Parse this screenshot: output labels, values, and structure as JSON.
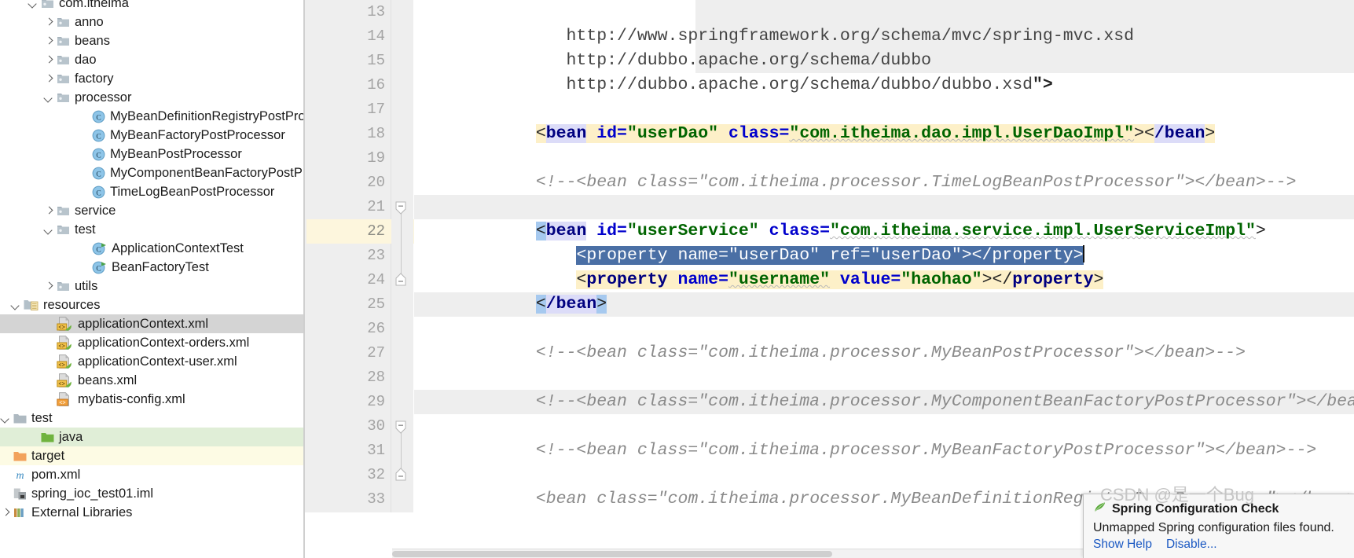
{
  "project_tree": {
    "items": [
      {
        "label": "com.itheima",
        "indent": 55,
        "arrow": "down",
        "icon": "package-icon",
        "state": "none"
      },
      {
        "label": "anno",
        "indent": 75,
        "arrow": "right",
        "icon": "package-icon",
        "state": "none"
      },
      {
        "label": "beans",
        "indent": 75,
        "arrow": "right",
        "icon": "package-icon",
        "state": "none"
      },
      {
        "label": "dao",
        "indent": 75,
        "arrow": "right",
        "icon": "package-icon",
        "state": "none"
      },
      {
        "label": "factory",
        "indent": 75,
        "arrow": "right",
        "icon": "package-icon",
        "state": "none"
      },
      {
        "label": "processor",
        "indent": 75,
        "arrow": "down",
        "icon": "package-icon",
        "state": "none"
      },
      {
        "label": "MyBeanDefinitionRegistryPostProcessor",
        "indent": 120,
        "arrow": "none",
        "icon": "class-icon",
        "state": "none"
      },
      {
        "label": "MyBeanFactoryPostProcessor",
        "indent": 120,
        "arrow": "none",
        "icon": "class-icon",
        "state": "none"
      },
      {
        "label": "MyBeanPostProcessor",
        "indent": 120,
        "arrow": "none",
        "icon": "class-icon",
        "state": "none"
      },
      {
        "label": "MyComponentBeanFactoryPostProcessor",
        "indent": 120,
        "arrow": "none",
        "icon": "class-icon",
        "state": "none"
      },
      {
        "label": "TimeLogBeanPostProcessor",
        "indent": 120,
        "arrow": "none",
        "icon": "class-icon",
        "state": "none"
      },
      {
        "label": "service",
        "indent": 75,
        "arrow": "right",
        "icon": "package-icon",
        "state": "none"
      },
      {
        "label": "test",
        "indent": 75,
        "arrow": "down",
        "icon": "package-icon",
        "state": "none"
      },
      {
        "label": "ApplicationContextTest",
        "indent": 120,
        "arrow": "none",
        "icon": "test-class-icon",
        "state": "none"
      },
      {
        "label": "BeanFactoryTest",
        "indent": 120,
        "arrow": "none",
        "icon": "test-class-icon",
        "state": "none"
      },
      {
        "label": "utils",
        "indent": 75,
        "arrow": "right",
        "icon": "package-icon",
        "state": "none"
      },
      {
        "label": "resources",
        "indent": 33,
        "arrow": "down",
        "icon": "resources-folder-icon",
        "state": "none"
      },
      {
        "label": "applicationContext.xml",
        "indent": 75,
        "arrow": "none",
        "icon": "spring-xml-icon",
        "state": "selected-gray"
      },
      {
        "label": "applicationContext-orders.xml",
        "indent": 75,
        "arrow": "none",
        "icon": "spring-xml-icon",
        "state": "none"
      },
      {
        "label": "applicationContext-user.xml",
        "indent": 75,
        "arrow": "none",
        "icon": "spring-xml-icon",
        "state": "none"
      },
      {
        "label": "beans.xml",
        "indent": 75,
        "arrow": "none",
        "icon": "spring-xml-icon",
        "state": "none"
      },
      {
        "label": "mybatis-config.xml",
        "indent": 75,
        "arrow": "none",
        "icon": "xml-icon",
        "state": "none"
      },
      {
        "label": "test",
        "indent": 10,
        "arrow": "down",
        "icon": "gray-folder-icon",
        "state": "none"
      },
      {
        "label": "java",
        "indent": 55,
        "arrow": "none",
        "icon": "green-folder-icon",
        "state": "highlight-green"
      },
      {
        "label": "target",
        "indent": 10,
        "arrow": "none",
        "icon": "orange-folder-icon",
        "state": "highlight-cream"
      },
      {
        "label": "pom.xml",
        "indent": 10,
        "arrow": "none",
        "icon": "maven-icon",
        "state": "none"
      },
      {
        "label": "spring_ioc_test01.iml",
        "indent": 10,
        "arrow": "none",
        "icon": "iml-icon",
        "state": "none"
      },
      {
        "label": "External Libraries",
        "indent": 10,
        "arrow": "right",
        "icon": "library-icon",
        "state": "none"
      }
    ]
  },
  "editor": {
    "line_numbers": [
      "13",
      "14",
      "15",
      "16",
      "17",
      "18",
      "19",
      "20",
      "21",
      "22",
      "23",
      "24",
      "25",
      "26",
      "27",
      "28",
      "29",
      "30",
      "31",
      "32",
      "33"
    ],
    "current_line": "22",
    "lines": [
      {
        "n": "13",
        "text": "       http://www.springframework.org/schema/mvc/spring-mvc.xsd"
      },
      {
        "n": "14",
        "text": "       http://dubbo.apache.org/schema/dubbo"
      },
      {
        "n": "15",
        "text": "       http://dubbo.apache.org/schema/dubbo/dubbo.xsd\">"
      },
      {
        "n": "16",
        "text": ""
      },
      {
        "n": "17",
        "text": "    <bean id=\"userDao\" class=\"com.itheima.dao.impl.UserDaoImpl\"></bean>"
      },
      {
        "n": "18",
        "text": ""
      },
      {
        "n": "19",
        "text": "    <!--<bean class=\"com.itheima.processor.TimeLogBeanPostProcessor\"></bean>-->"
      },
      {
        "n": "20",
        "text": ""
      },
      {
        "n": "21",
        "text": "    <bean id=\"userService\" class=\"com.itheima.service.impl.UserServiceImpl\">"
      },
      {
        "n": "22",
        "text": "        <property name=\"userDao\" ref=\"userDao\"></property>"
      },
      {
        "n": "23",
        "text": "        <property name=\"username\" value=\"haohao\"></property>"
      },
      {
        "n": "24",
        "text": "    </bean>"
      },
      {
        "n": "25",
        "text": ""
      },
      {
        "n": "26",
        "text": "    <!--<bean class=\"com.itheima.processor.MyBeanPostProcessor\"></bean>-->"
      },
      {
        "n": "27",
        "text": ""
      },
      {
        "n": "28",
        "text": "    <!--<bean class=\"com.itheima.processor.MyComponentBeanFactoryPostProcessor\"></bean>-->"
      },
      {
        "n": "29",
        "text": ""
      },
      {
        "n": "30",
        "text": "    <!--<bean class=\"com.itheima.processor.MyBeanFactoryPostProcessor\"></bean>-->"
      },
      {
        "n": "31",
        "text": ""
      },
      {
        "n": "32",
        "text": "    <bean class=\"com.itheima.processor.MyBeanDefinitionRegistryPostProcessor\"></bean>"
      },
      {
        "n": "33",
        "text": ""
      }
    ],
    "tok": {
      "l13": "       http://www.springframework.org/schema/mvc/spring-mvc.xsd",
      "l14": "       http://dubbo.apache.org/schema/dubbo",
      "l15a": "       http://dubbo.apache.org/schema/dubbo/dubbo.xsd",
      "l15b": "\">",
      "l17_lt": "<",
      "l17_bean": "bean",
      "l17_sp": " ",
      "l17_id": "id=",
      "l17_idv": "\"userDao\"",
      "l17_cls": "class=",
      "l17_clsv": "\"com.itheima.dao.impl.UserDaoImpl\"",
      "l17_gt": "><",
      "l17_close": "/bean",
      "l17_endgt": ">",
      "l19": "<!--<bean class=\"com.itheima.processor.TimeLogBeanPostProcessor\"></bean>-->",
      "l21_lt": "<",
      "l21_bean": "bean",
      "l21_id": "id=",
      "l21_idv": "\"userService\"",
      "l21_cls": "class=",
      "l21_clsv": "\"com.itheima.service.impl.UserServiceImpl\"",
      "l21_gt": ">",
      "l22": "<property name=\"userDao\" ref=\"userDao\"></property>",
      "l23_lt": "<",
      "l23_prop": "property",
      "l23_name": "name=",
      "l23_namev": "\"username\"",
      "l23_value": "value=",
      "l23_valuev": "\"haohao\"",
      "l23_gt": "></",
      "l23_close": "property",
      "l23_endgt": ">",
      "l24_lt": "<",
      "l24_close": "/bean",
      "l24_gt": ">",
      "l26": "<!--<bean class=\"com.itheima.processor.MyBeanPostProcessor\"></bean>-->",
      "l28": "<!--<bean class=\"com.itheima.processor.MyComponentBeanFactoryPostProcessor\"></bean>-->",
      "l30": "<!--<bean class=\"com.itheima.processor.MyBeanFactoryPostProcessor\"></bean>-->",
      "l32_lt": "<bean ",
      "l32_cls": "class=",
      "l32_clsv": "\"com.itheima.processor.MyBeanDefinitionRegistryPostProcessor\"",
      "l32_gt": "></bean>"
    }
  },
  "notification": {
    "icon": "spring-leaf-icon",
    "title": "Spring Configuration Check",
    "message": "Unmapped Spring configuration files found.",
    "links": [
      {
        "label": "Show Help"
      },
      {
        "label": "Disable..."
      }
    ]
  },
  "watermark": {
    "text": "CSDN @是一个Bug"
  },
  "colors": {
    "selection_blue": "#4a6fa5",
    "current_line_yellow": "#fdf0c8",
    "tag_navy": "#000080",
    "attr_blue": "#0000cc",
    "value_green": "#006400",
    "comment_gray": "#8a8a8a",
    "link_blue": "#1a58c2"
  }
}
